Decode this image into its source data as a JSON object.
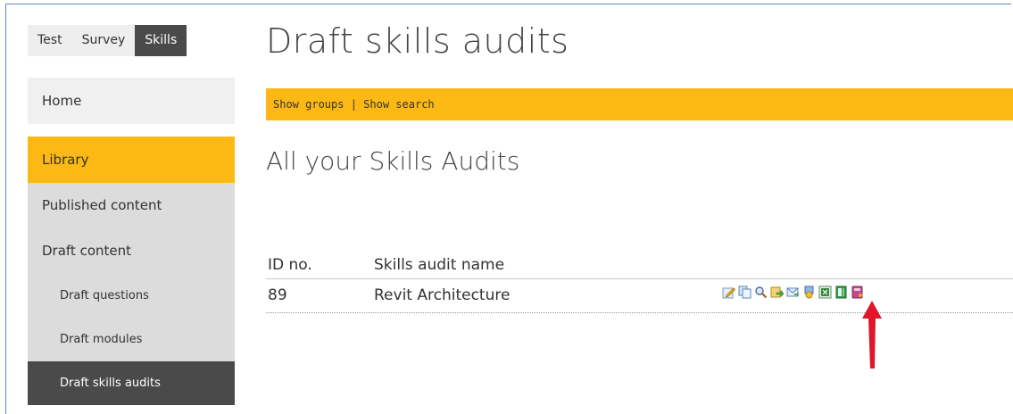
{
  "top_tabs": [
    "Test",
    "Survey",
    "Skills"
  ],
  "sidebar": {
    "home": "Home",
    "library": "Library",
    "published": "Published content",
    "draft": "Draft content",
    "draft_questions": "Draft questions",
    "draft_modules": "Draft modules",
    "draft_skills_audits": "Draft skills audits"
  },
  "main": {
    "title": "Draft skills audits",
    "show_groups": "Show groups",
    "separator": " | ",
    "show_search": "Show search",
    "section_title": "All your Skills Audits",
    "table": {
      "headers": [
        "ID no.",
        "Skills audit name"
      ],
      "rows": [
        {
          "id": "89",
          "name": "Revit Architecture"
        }
      ]
    },
    "action_icons": [
      "edit-icon",
      "copy-icon",
      "preview-icon",
      "publish-icon",
      "email-icon",
      "award-icon",
      "export-icon",
      "report-icon",
      "book-icon"
    ]
  },
  "colors": {
    "accent": "#fdb913",
    "dark": "#4a4a4a",
    "arrow": "#e0162b"
  }
}
